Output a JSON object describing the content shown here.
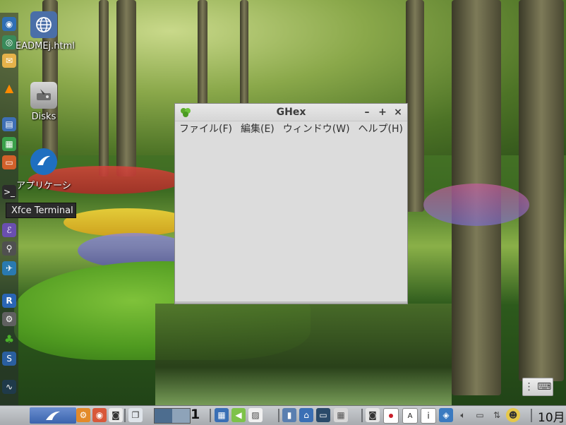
{
  "window": {
    "title": "GHex",
    "minimize": "–",
    "maximize": "+",
    "close": "×",
    "menu": [
      {
        "label": "ファイル(F)"
      },
      {
        "label": "編集(E)"
      },
      {
        "label": "ウィンドウ(W)"
      },
      {
        "label": "ヘルプ(H)"
      }
    ]
  },
  "desktop": {
    "items": [
      {
        "label": "EADMEj.html",
        "icon": "globe-icon"
      },
      {
        "label": "Disks",
        "icon": "disk-icon"
      },
      {
        "label": "アプリケーシ",
        "icon": "lubuntu-bird-icon"
      }
    ],
    "tooltip": "Xfce Terminal"
  },
  "keyboard_widget": {
    "icon": "keyboard-icon"
  },
  "taskbar": {
    "workspace_number": "1",
    "clock": "10月"
  }
}
